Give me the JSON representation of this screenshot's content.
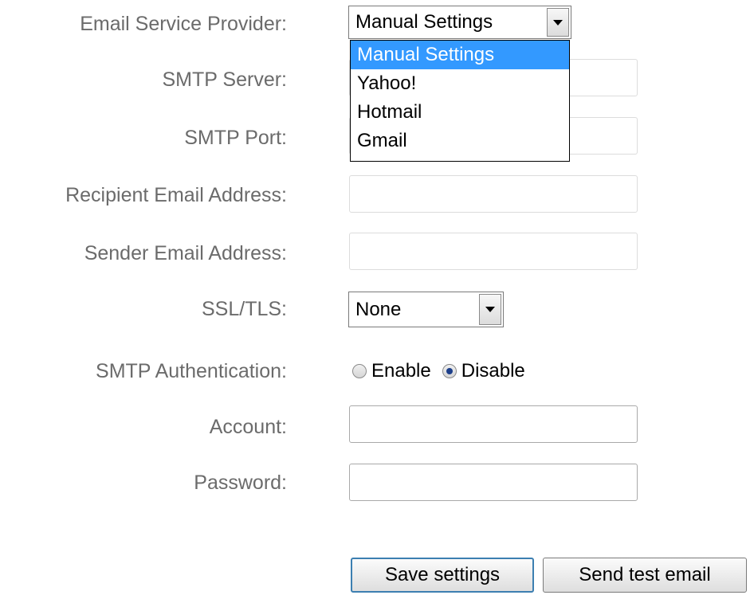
{
  "labels": {
    "email_service_provider": "Email Service Provider:",
    "smtp_server": "SMTP Server:",
    "smtp_port": "SMTP Port:",
    "recipient_email": "Recipient Email Address:",
    "sender_email": "Sender Email Address:",
    "ssl_tls": "SSL/TLS:",
    "smtp_auth": "SMTP Authentication:",
    "account": "Account:",
    "password": "Password:"
  },
  "provider_select": {
    "value": "Manual Settings",
    "options": [
      "Manual Settings",
      "Yahoo!",
      "Hotmail",
      "Gmail"
    ]
  },
  "ssl_select": {
    "value": "None"
  },
  "smtp_auth_options": {
    "enable": "Enable",
    "disable": "Disable",
    "selected": "Disable"
  },
  "buttons": {
    "save": "Save settings",
    "test": "Send test email"
  }
}
